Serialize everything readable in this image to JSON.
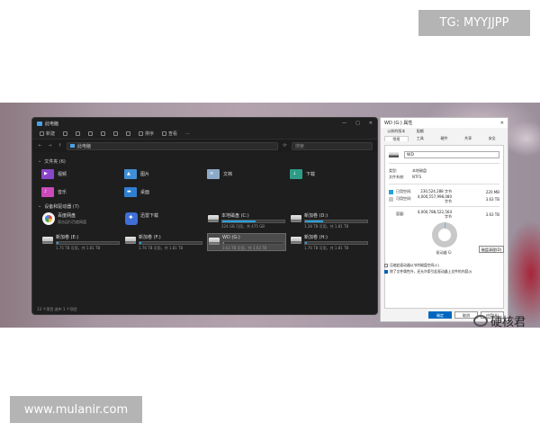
{
  "watermarks": {
    "top": "TG: MYYJJPP",
    "bottom": "www.mulanir.com"
  },
  "explorer": {
    "title": "此电脑",
    "window_controls": [
      "—",
      "□",
      "✕"
    ],
    "commands": [
      "新建",
      "排序",
      "查看"
    ],
    "address": "此电脑",
    "nav": [
      "←",
      "→",
      "↑",
      "⟳"
    ],
    "search_placeholder": "搜索",
    "sections": {
      "folders": "文件夹 (6)",
      "devices": "设备和驱动器 (7)"
    },
    "folders": [
      {
        "label": "视频",
        "color": "#8a46c9",
        "icon": "video-folder-icon"
      },
      {
        "label": "图片",
        "color": "#3f8fd6",
        "icon": "pictures-folder-icon"
      },
      {
        "label": "文档",
        "color": "#8da9c8",
        "icon": "documents-folder-icon"
      },
      {
        "label": "下载",
        "color": "#2e9c86",
        "icon": "downloads-folder-icon"
      },
      {
        "label": "音乐",
        "color": "#c94ab8",
        "icon": "music-folder-icon"
      },
      {
        "label": "桌面",
        "color": "#2f7fd1",
        "icon": "desktop-folder-icon"
      }
    ],
    "devices": [
      {
        "name": "百度网盘",
        "sub": "双击运行百度网盘",
        "icon": "baidu-netdisk-icon"
      },
      {
        "name": "迅雷下载",
        "sub": "",
        "icon": "xunlei-icon"
      },
      {
        "name": "本地磁盘 (C:)",
        "free": "224 GB 可用，共 475 GB",
        "usage": 0.53,
        "icon": "drive-icon"
      },
      {
        "name": "新加卷 (D:)",
        "free": "1.28 TB 可用，共 1.81 TB",
        "usage": 0.29,
        "icon": "drive-icon"
      },
      {
        "name": "新加卷 (E:)",
        "free": "1.75 TB 可用，共 1.81 TB",
        "usage": 0.03,
        "icon": "drive-icon"
      },
      {
        "name": "新加卷 (F:)",
        "free": "1.76 TB 可用，共 1.81 TB",
        "usage": 0.03,
        "icon": "drive-icon"
      },
      {
        "name": "WD (G:)",
        "free": "3.63 TB 可用，共 3.63 TB",
        "usage": 0.005,
        "icon": "drive-icon",
        "selected": true
      },
      {
        "name": "新加卷 (H:)",
        "free": "1.76 TB 可用，共 1.81 TB",
        "usage": 0.03,
        "icon": "drive-icon"
      }
    ],
    "status": "13 个项目    选中 1 个项目"
  },
  "properties": {
    "title": "WD (G:) 属性",
    "close": "✕",
    "tabs_row1": [
      "以前的版本",
      "配额",
      "",
      "",
      ""
    ],
    "tabs_row2": [
      "常规",
      "工具",
      "硬件",
      "共享",
      "安全"
    ],
    "volume_name": "WD",
    "type_label": "类型:",
    "type_value": "本地磁盘",
    "fs_label": "文件系统:",
    "fs_value": "NTFS",
    "used": {
      "label": "已用空间:",
      "bytes": "230,524,288 字节",
      "size": "220 MB",
      "color": "#26a0da"
    },
    "free": {
      "label": "可用空间:",
      "bytes": "4,000,557,998,080 字节",
      "size": "3.63 TB",
      "color": "#c8c8c8"
    },
    "capacity": {
      "label": "容量:",
      "bytes": "4,000,788,522,564 字节",
      "size": "3.63 TB"
    },
    "used_fraction": 0.005,
    "drive_label": "驱动器 G:",
    "cleanup_button": "磁盘清理(D)",
    "checks": [
      {
        "label": "压缩此驱动器以节约磁盘空间(C)",
        "checked": false
      },
      {
        "label": "除了文件属性外，还允许索引此驱动器上文件的内容(I)",
        "checked": true
      }
    ],
    "buttons": [
      "确定",
      "取消",
      "应用(A)"
    ]
  },
  "weibo": {
    "text": "硬核君"
  }
}
